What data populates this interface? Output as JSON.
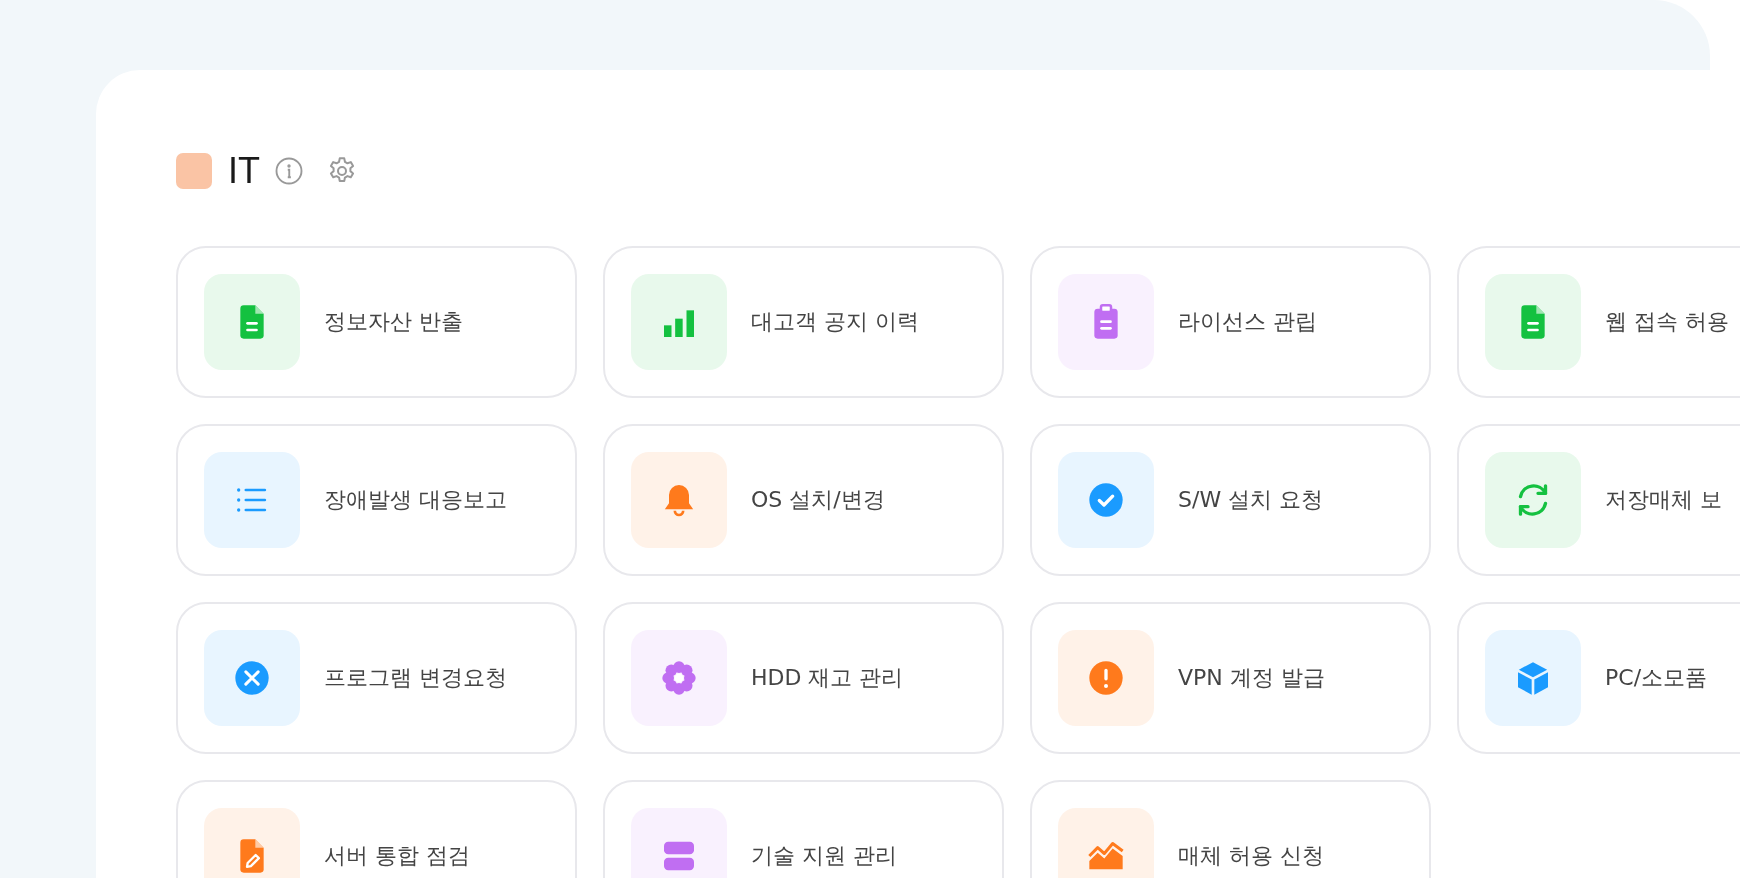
{
  "section": {
    "title": "IT"
  },
  "items": [
    {
      "label": "정보자산 반출",
      "kind": "document",
      "color": "#14c140"
    },
    {
      "label": "대고객 공지 이력",
      "kind": "barchart",
      "color": "#14c140"
    },
    {
      "label": "라이선스 관립",
      "kind": "clipboard",
      "color": "#c06ef2"
    },
    {
      "label": "웹 접속 허용",
      "kind": "document",
      "color": "#14c140"
    },
    {
      "label": "장애발생 대응보고",
      "kind": "list",
      "color": "#1a9bff"
    },
    {
      "label": "OS 설치/변경",
      "kind": "bell",
      "color": "#ff7a1c"
    },
    {
      "label": "S/W 설치 요청",
      "kind": "check",
      "color": "#1a9bff"
    },
    {
      "label": "저장매체 보",
      "kind": "refresh",
      "color": "#14c140"
    },
    {
      "label": "프로그램 변경요청",
      "kind": "cross",
      "color": "#1a9bff"
    },
    {
      "label": "HDD 재고 관리",
      "kind": "flower",
      "color": "#c06ef2"
    },
    {
      "label": "VPN 계정 발급",
      "kind": "alert",
      "color": "#ff7a1c"
    },
    {
      "label": "PC/소모품",
      "kind": "cube",
      "color": "#1a9bff"
    },
    {
      "label": "서버 통합 점검",
      "kind": "edit",
      "color": "#ff7a1c"
    },
    {
      "label": "기술 지원 관리",
      "kind": "stack",
      "color": "#c06ef2"
    },
    {
      "label": "매체 허용 신청",
      "kind": "areachart",
      "color": "#ff7a1c"
    }
  ]
}
